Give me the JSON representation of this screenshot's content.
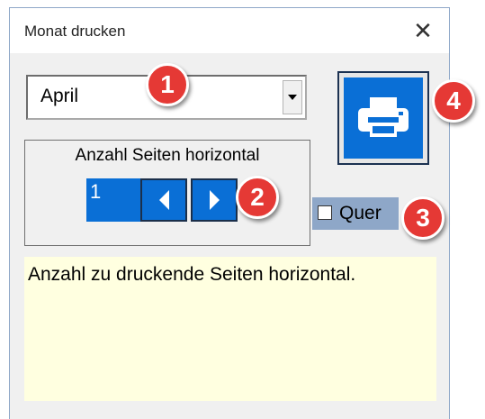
{
  "dialog": {
    "title": "Monat drucken",
    "close_glyph": "✕"
  },
  "month_select": {
    "value": "April"
  },
  "pages_frame": {
    "label": "Anzahl Seiten horizontal",
    "value": "1"
  },
  "landscape": {
    "label": "Quer",
    "checked": false
  },
  "description": {
    "text": "Anzahl zu druckende Seiten horizontal."
  },
  "badges": [
    "1",
    "2",
    "3",
    "4"
  ],
  "icons": {
    "print": "printer-icon",
    "prev": "arrow-left-icon",
    "next": "arrow-right-icon",
    "dropdown": "chevron-down-icon"
  },
  "colors": {
    "accent": "#0a6fd6",
    "badge": "#e53935",
    "description_bg": "#ffffe0",
    "quer_bg": "#8ea7c8"
  }
}
